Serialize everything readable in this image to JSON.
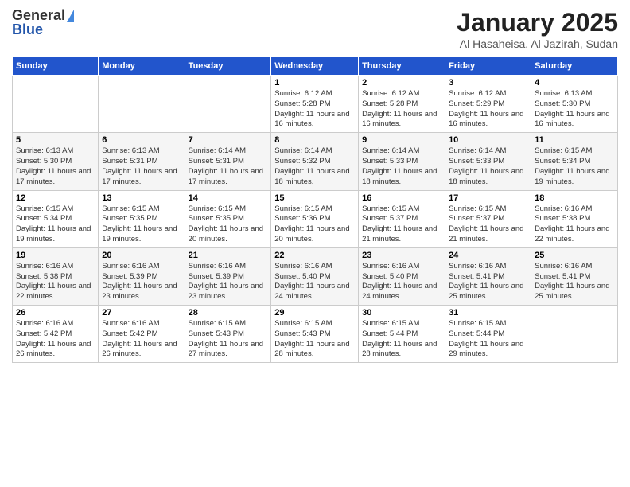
{
  "header": {
    "logo_general": "General",
    "logo_blue": "Blue",
    "title": "January 2025",
    "subtitle": "Al Hasaheisa, Al Jazirah, Sudan"
  },
  "days_of_week": [
    "Sunday",
    "Monday",
    "Tuesday",
    "Wednesday",
    "Thursday",
    "Friday",
    "Saturday"
  ],
  "weeks": [
    [
      {
        "day": "",
        "info": ""
      },
      {
        "day": "",
        "info": ""
      },
      {
        "day": "",
        "info": ""
      },
      {
        "day": "1",
        "info": "Sunrise: 6:12 AM\nSunset: 5:28 PM\nDaylight: 11 hours and 16 minutes."
      },
      {
        "day": "2",
        "info": "Sunrise: 6:12 AM\nSunset: 5:28 PM\nDaylight: 11 hours and 16 minutes."
      },
      {
        "day": "3",
        "info": "Sunrise: 6:12 AM\nSunset: 5:29 PM\nDaylight: 11 hours and 16 minutes."
      },
      {
        "day": "4",
        "info": "Sunrise: 6:13 AM\nSunset: 5:30 PM\nDaylight: 11 hours and 16 minutes."
      }
    ],
    [
      {
        "day": "5",
        "info": "Sunrise: 6:13 AM\nSunset: 5:30 PM\nDaylight: 11 hours and 17 minutes."
      },
      {
        "day": "6",
        "info": "Sunrise: 6:13 AM\nSunset: 5:31 PM\nDaylight: 11 hours and 17 minutes."
      },
      {
        "day": "7",
        "info": "Sunrise: 6:14 AM\nSunset: 5:31 PM\nDaylight: 11 hours and 17 minutes."
      },
      {
        "day": "8",
        "info": "Sunrise: 6:14 AM\nSunset: 5:32 PM\nDaylight: 11 hours and 18 minutes."
      },
      {
        "day": "9",
        "info": "Sunrise: 6:14 AM\nSunset: 5:33 PM\nDaylight: 11 hours and 18 minutes."
      },
      {
        "day": "10",
        "info": "Sunrise: 6:14 AM\nSunset: 5:33 PM\nDaylight: 11 hours and 18 minutes."
      },
      {
        "day": "11",
        "info": "Sunrise: 6:15 AM\nSunset: 5:34 PM\nDaylight: 11 hours and 19 minutes."
      }
    ],
    [
      {
        "day": "12",
        "info": "Sunrise: 6:15 AM\nSunset: 5:34 PM\nDaylight: 11 hours and 19 minutes."
      },
      {
        "day": "13",
        "info": "Sunrise: 6:15 AM\nSunset: 5:35 PM\nDaylight: 11 hours and 19 minutes."
      },
      {
        "day": "14",
        "info": "Sunrise: 6:15 AM\nSunset: 5:35 PM\nDaylight: 11 hours and 20 minutes."
      },
      {
        "day": "15",
        "info": "Sunrise: 6:15 AM\nSunset: 5:36 PM\nDaylight: 11 hours and 20 minutes."
      },
      {
        "day": "16",
        "info": "Sunrise: 6:15 AM\nSunset: 5:37 PM\nDaylight: 11 hours and 21 minutes."
      },
      {
        "day": "17",
        "info": "Sunrise: 6:15 AM\nSunset: 5:37 PM\nDaylight: 11 hours and 21 minutes."
      },
      {
        "day": "18",
        "info": "Sunrise: 6:16 AM\nSunset: 5:38 PM\nDaylight: 11 hours and 22 minutes."
      }
    ],
    [
      {
        "day": "19",
        "info": "Sunrise: 6:16 AM\nSunset: 5:38 PM\nDaylight: 11 hours and 22 minutes."
      },
      {
        "day": "20",
        "info": "Sunrise: 6:16 AM\nSunset: 5:39 PM\nDaylight: 11 hours and 23 minutes."
      },
      {
        "day": "21",
        "info": "Sunrise: 6:16 AM\nSunset: 5:39 PM\nDaylight: 11 hours and 23 minutes."
      },
      {
        "day": "22",
        "info": "Sunrise: 6:16 AM\nSunset: 5:40 PM\nDaylight: 11 hours and 24 minutes."
      },
      {
        "day": "23",
        "info": "Sunrise: 6:16 AM\nSunset: 5:40 PM\nDaylight: 11 hours and 24 minutes."
      },
      {
        "day": "24",
        "info": "Sunrise: 6:16 AM\nSunset: 5:41 PM\nDaylight: 11 hours and 25 minutes."
      },
      {
        "day": "25",
        "info": "Sunrise: 6:16 AM\nSunset: 5:41 PM\nDaylight: 11 hours and 25 minutes."
      }
    ],
    [
      {
        "day": "26",
        "info": "Sunrise: 6:16 AM\nSunset: 5:42 PM\nDaylight: 11 hours and 26 minutes."
      },
      {
        "day": "27",
        "info": "Sunrise: 6:16 AM\nSunset: 5:42 PM\nDaylight: 11 hours and 26 minutes."
      },
      {
        "day": "28",
        "info": "Sunrise: 6:15 AM\nSunset: 5:43 PM\nDaylight: 11 hours and 27 minutes."
      },
      {
        "day": "29",
        "info": "Sunrise: 6:15 AM\nSunset: 5:43 PM\nDaylight: 11 hours and 28 minutes."
      },
      {
        "day": "30",
        "info": "Sunrise: 6:15 AM\nSunset: 5:44 PM\nDaylight: 11 hours and 28 minutes."
      },
      {
        "day": "31",
        "info": "Sunrise: 6:15 AM\nSunset: 5:44 PM\nDaylight: 11 hours and 29 minutes."
      },
      {
        "day": "",
        "info": ""
      }
    ]
  ]
}
